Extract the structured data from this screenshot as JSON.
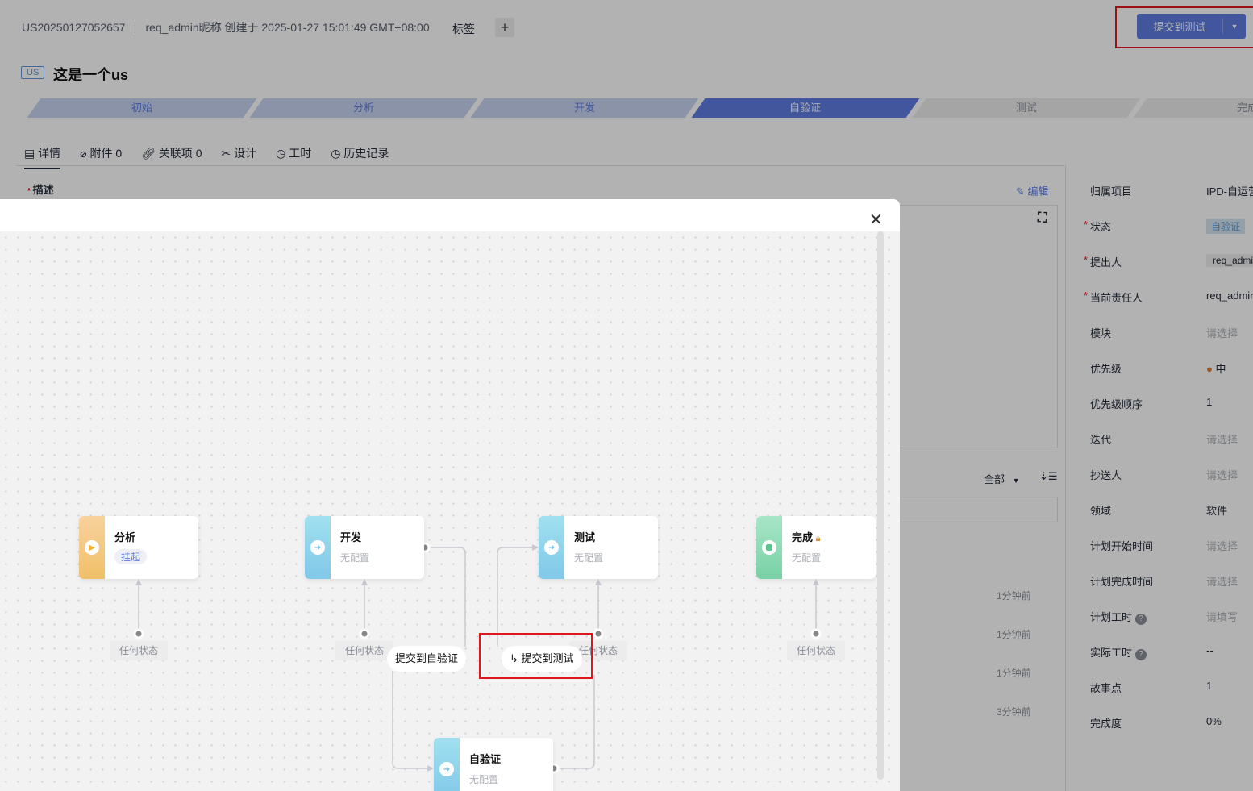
{
  "header": {
    "id": "US20250127052657",
    "creator": "req_admin昵称 创建于 2025-01-27 15:01:49 GMT+08:00",
    "tag_label": "标签",
    "add_tag": "+",
    "submit_label": "提交到测试",
    "type_badge": "US",
    "title": "这是一个us"
  },
  "steps": [
    {
      "label": "初始",
      "state": "done"
    },
    {
      "label": "分析",
      "state": "done"
    },
    {
      "label": "开发",
      "state": "done"
    },
    {
      "label": "自验证",
      "state": "current"
    },
    {
      "label": "测试",
      "state": "todo"
    },
    {
      "label": "完成",
      "state": "todo"
    }
  ],
  "tabs": [
    "详情",
    "附件 0",
    "关联项 0",
    "设计",
    "工时",
    "历史记录"
  ],
  "desc": {
    "label": "描述",
    "edit": "编辑"
  },
  "filter": {
    "all": "全部"
  },
  "timestamps": [
    "1分钟前",
    "1分钟前",
    "1分钟前",
    "3分钟前"
  ],
  "props": [
    {
      "label": "归属项目",
      "value": "IPD-自运营",
      "req": false
    },
    {
      "label": "状态",
      "value": "自验证",
      "req": true
    },
    {
      "label": "提出人",
      "value": "req_admin",
      "req": true
    },
    {
      "label": "当前责任人",
      "value": "req_admin",
      "req": true
    },
    {
      "label": "模块",
      "value": "请选择",
      "req": false
    },
    {
      "label": "优先级",
      "value": "中",
      "req": false
    },
    {
      "label": "优先级顺序",
      "value": "1",
      "req": false
    },
    {
      "label": "迭代",
      "value": "请选择",
      "req": false
    },
    {
      "label": "抄送人",
      "value": "请选择",
      "req": false
    },
    {
      "label": "领域",
      "value": "软件",
      "req": false
    },
    {
      "label": "计划开始时间",
      "value": "请选择",
      "req": false
    },
    {
      "label": "计划完成时间",
      "value": "请选择",
      "req": false
    },
    {
      "label": "计划工时",
      "value": "请填写",
      "req": false
    },
    {
      "label": "实际工时",
      "value": "--",
      "req": false
    },
    {
      "label": "故事点",
      "value": "1",
      "req": false
    },
    {
      "label": "完成度",
      "value": "0%",
      "req": false
    }
  ],
  "flow": {
    "nodes": [
      {
        "name": "分析",
        "sub": "挂起"
      },
      {
        "name": "开发",
        "sub": "无配置"
      },
      {
        "name": "测试",
        "sub": "无配置"
      },
      {
        "name": "完成",
        "sub": "无配置"
      },
      {
        "name": "自验证",
        "sub": "无配置"
      }
    ],
    "any_state": "任何状态",
    "transitions": [
      "提交到自验证",
      "提交到测试"
    ]
  },
  "colors": {
    "accent": "#5e7ce0",
    "highlight": "#e0161e"
  }
}
